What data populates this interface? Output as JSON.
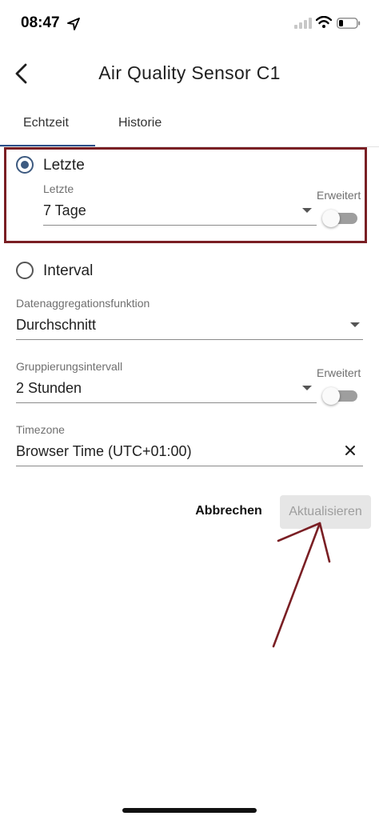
{
  "status_bar": {
    "time": "08:47"
  },
  "header": {
    "title": "Air Quality Sensor C1"
  },
  "tabs": [
    {
      "label": "Echtzeit",
      "active": true
    },
    {
      "label": "Historie",
      "active": false
    }
  ],
  "letzte": {
    "radio_label": "Letzte",
    "selected": true,
    "field_label": "Letzte",
    "value": "7 Tage",
    "toggle_label": "Erweitert",
    "toggle_on": false
  },
  "interval": {
    "radio_label": "Interval",
    "selected": false
  },
  "aggregation": {
    "label": "Datenaggregationsfunktion",
    "value": "Durchschnitt"
  },
  "grouping": {
    "label": "Gruppierungsintervall",
    "value": "2 Stunden",
    "toggle_label": "Erweitert",
    "toggle_on": false
  },
  "timezone": {
    "label": "Timezone",
    "value": "Browser Time (UTC+01:00)"
  },
  "actions": {
    "cancel": "Abbrechen",
    "update": "Aktualisieren"
  },
  "colors": {
    "accent": "#3d5a80",
    "highlight": "#7a1f24",
    "tab_indicator": "#2a4f8a"
  },
  "icons": [
    "location-arrow-icon",
    "signal-icon",
    "wifi-icon",
    "battery-icon",
    "back-chevron-icon",
    "dropdown-caret-icon",
    "clear-icon"
  ]
}
